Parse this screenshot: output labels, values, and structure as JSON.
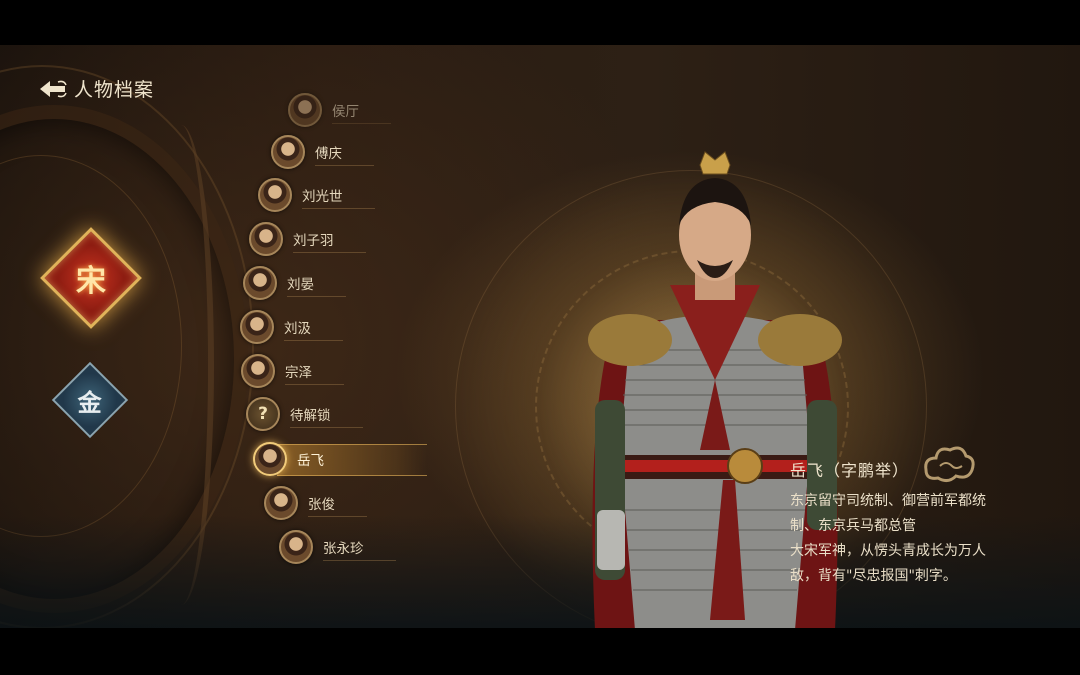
{
  "header": {
    "title": "人物档案"
  },
  "factions": [
    {
      "label": "宋",
      "selected": true
    },
    {
      "label": "金",
      "selected": false
    }
  ],
  "characters": [
    {
      "name": "侯厅",
      "avatar": "portrait"
    },
    {
      "name": "傅庆",
      "avatar": "portrait"
    },
    {
      "name": "刘光世",
      "avatar": "portrait"
    },
    {
      "name": "刘子羽",
      "avatar": "portrait"
    },
    {
      "name": "刘晏",
      "avatar": "portrait"
    },
    {
      "name": "刘汲",
      "avatar": "portrait"
    },
    {
      "name": "宗泽",
      "avatar": "portrait"
    },
    {
      "name": "待解锁",
      "avatar": "?"
    },
    {
      "name": "岳飞",
      "avatar": "portrait",
      "selected": true
    },
    {
      "name": "张俊",
      "avatar": "portrait"
    },
    {
      "name": "张永珍",
      "avatar": "portrait"
    }
  ],
  "detail": {
    "title": "岳飞（字鹏举）",
    "line1": "东京留守司统制、御营前军都统",
    "line2": "制、东京兵马都总管",
    "line3": "大宋军神，从愣头青成长为万人",
    "line4": "敌，背有\"尽忠报国\"刺字。"
  },
  "colors": {
    "accent": "#d9a653",
    "song_badge": "#b32a1a",
    "jin_badge": "#2f4f63"
  }
}
